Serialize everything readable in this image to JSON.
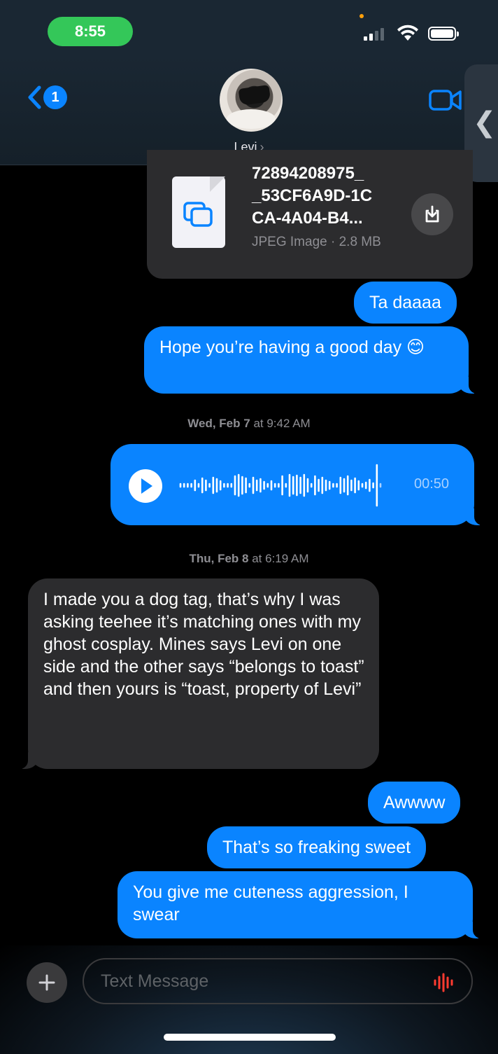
{
  "status_bar": {
    "time": "8:55",
    "signal_icon": "cellular-signal-icon",
    "wifi_icon": "wifi-icon",
    "battery_icon": "battery-icon",
    "battery_level": 1.0
  },
  "header": {
    "back_badge_count": "1",
    "contact_name": "Levi",
    "name_chevron": "›",
    "video_icon": "video-camera-icon",
    "side_panel_chevron": "❮"
  },
  "file_attachment": {
    "file_name": "72894208975_ _53CF6A9D-1C CA-4A04-B4...",
    "file_name_lines": [
      "72894208975_",
      "_53CF6A9D-1C",
      "CA-4A04-B4..."
    ],
    "file_meta": "JPEG Image · 2.8 MB",
    "file_icon": "document-image-icon",
    "download_icon": "download-icon"
  },
  "messages": [
    {
      "sender": "me",
      "text": "Ta daaaa"
    },
    {
      "sender": "me",
      "text": "Hope you’re having a good day 😊"
    },
    {
      "sender": "them",
      "text": "I made you a dog tag, that’s why I was asking teehee it’s matching ones with my ghost cosplay. Mines says Levi on one side and the other says “belongs to toast” and then yours is “toast, property of Levi”"
    },
    {
      "sender": "me",
      "text": "Awwww"
    },
    {
      "sender": "me",
      "text": "That’s so freaking sweet"
    },
    {
      "sender": "me",
      "text": "You give me cuteness aggression, I swear"
    }
  ],
  "timestamps": [
    {
      "day": "Wed, Feb 7",
      "time": "at 9:42 AM"
    },
    {
      "day": "Thu, Feb 8",
      "time": "at 6:19 AM"
    }
  ],
  "audio_message": {
    "duration": "00:50",
    "play_icon": "play-icon"
  },
  "input_bar": {
    "placeholder": "Text Message",
    "plus_icon": "plus-icon",
    "mic_icon": "audio-waveform-icon"
  },
  "colors": {
    "sent_bubble": "#0a84ff",
    "received_bubble": "#2c2c2e",
    "background": "#000000",
    "time_pill": "#34c759"
  }
}
